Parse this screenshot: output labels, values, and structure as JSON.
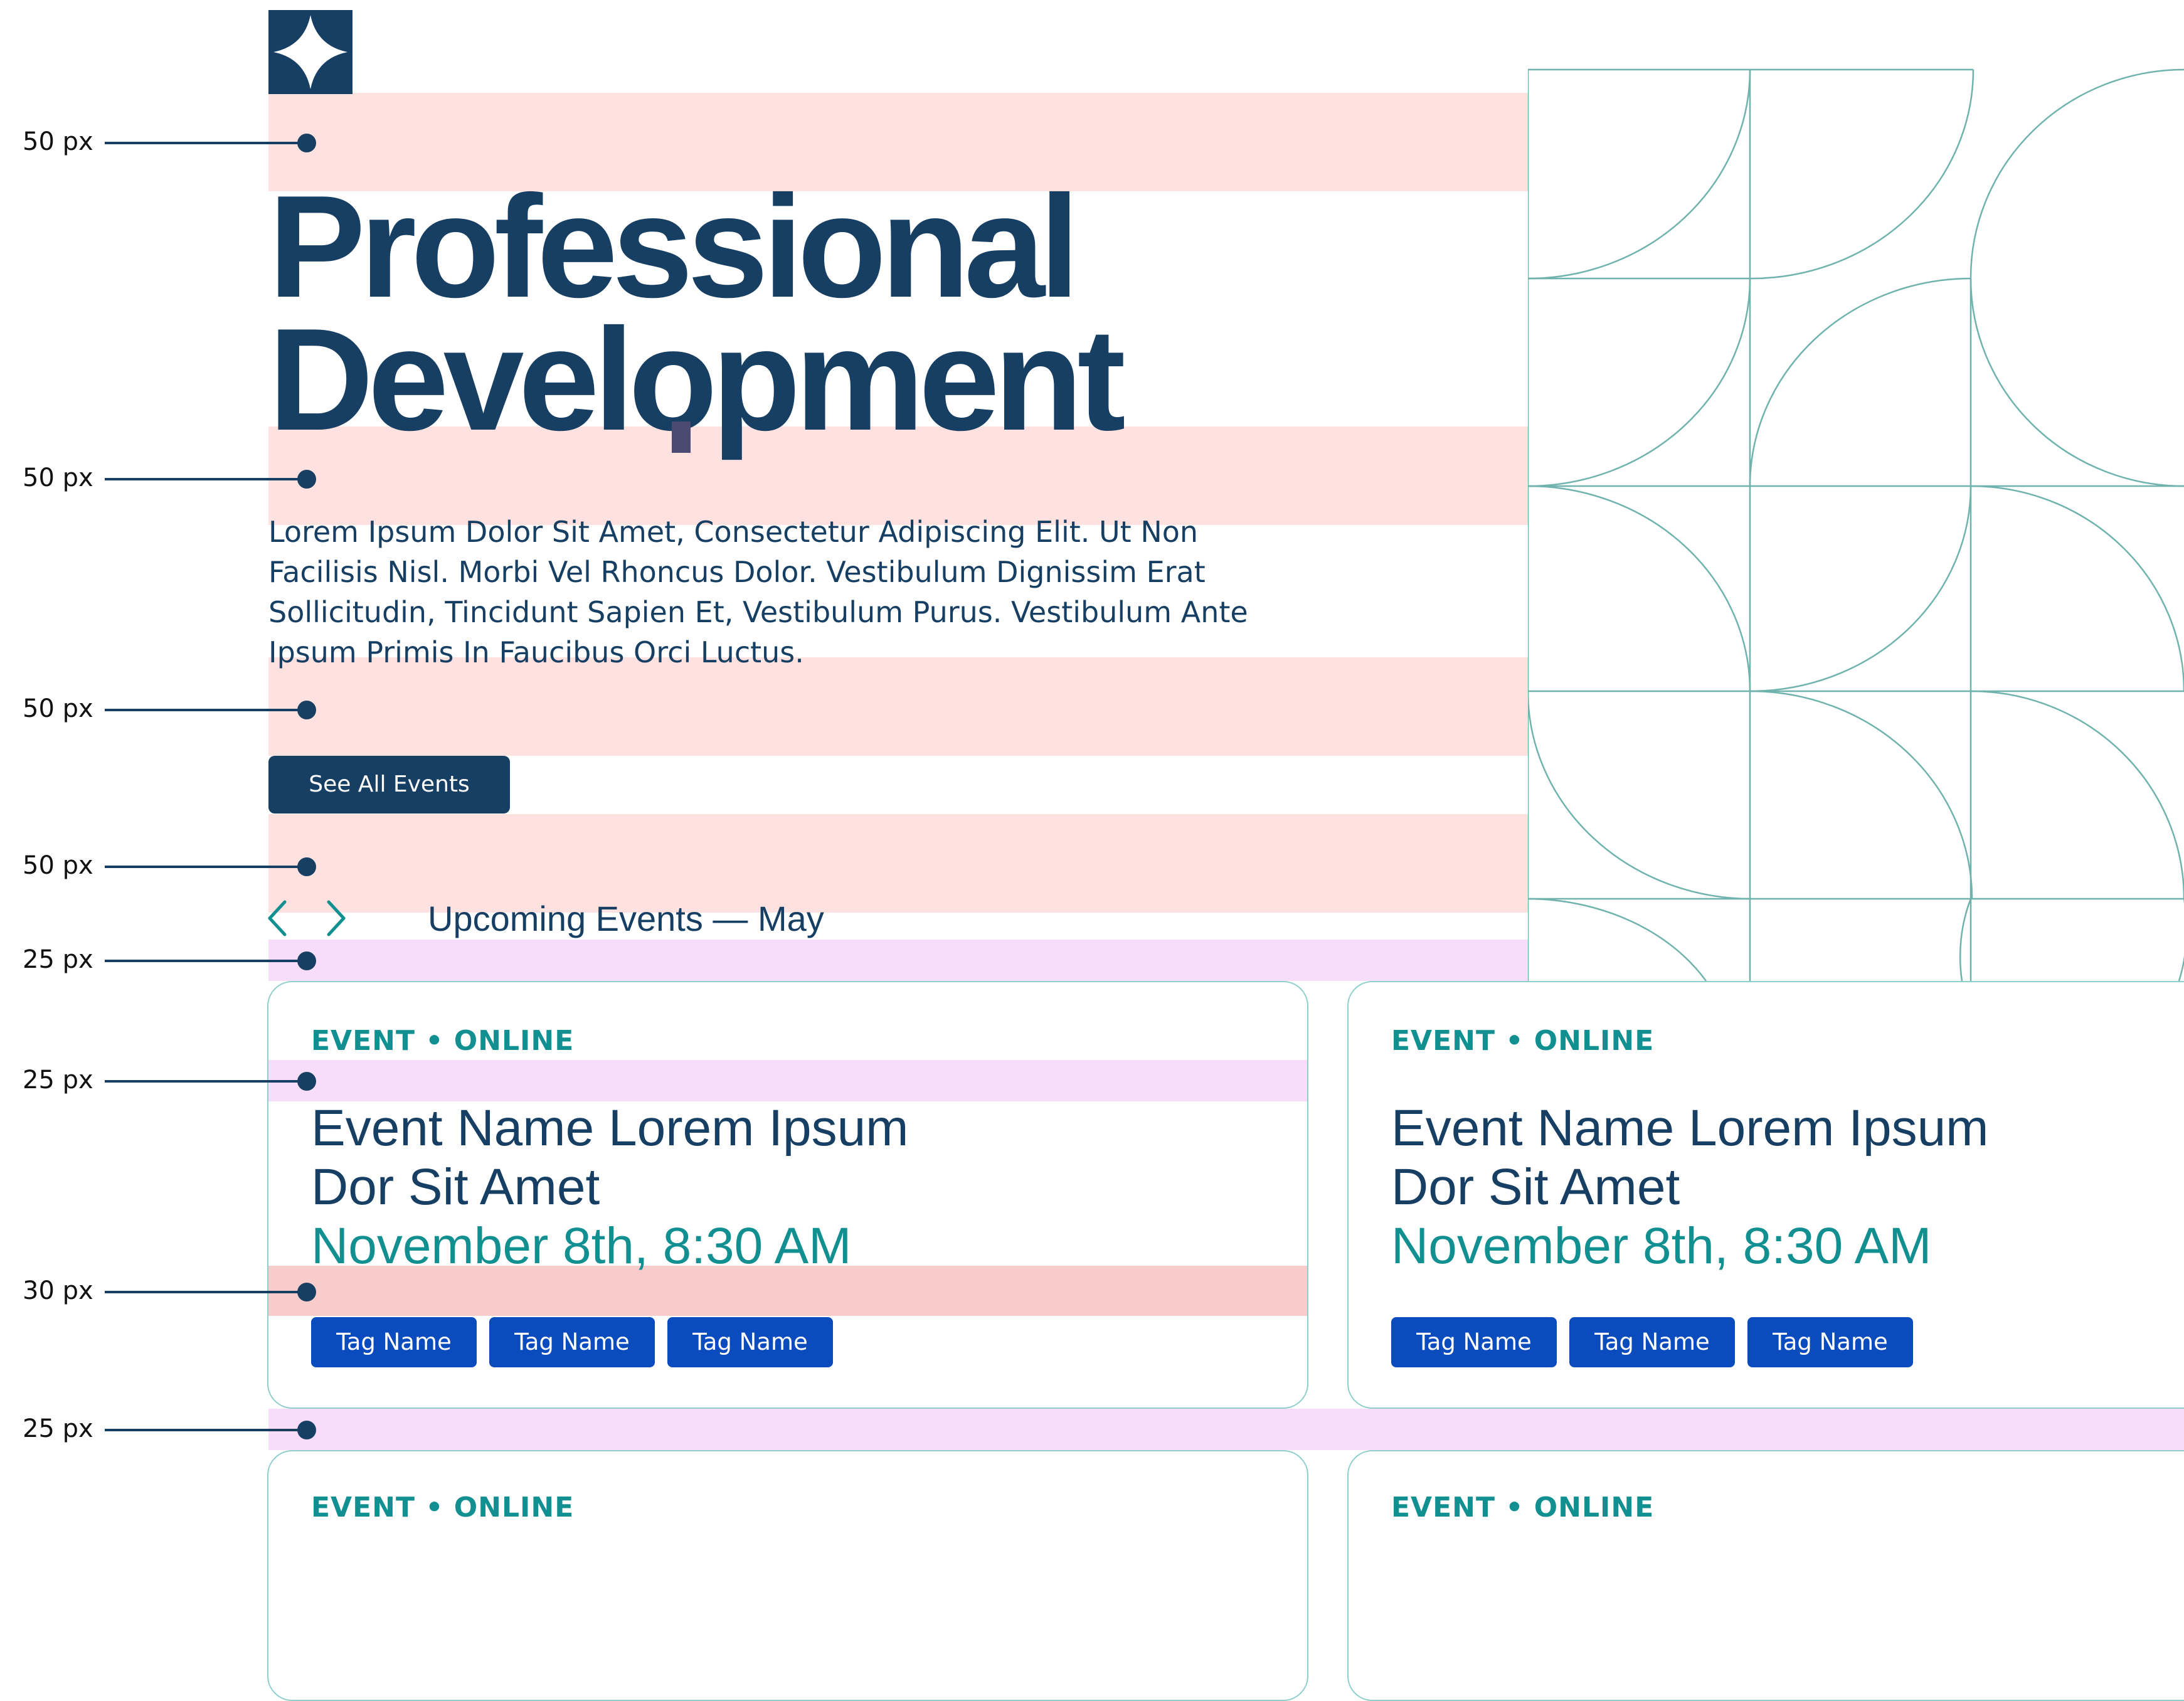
{
  "hero": {
    "title_line1": "Professional",
    "title_line2": "Development",
    "description": "Lorem Ipsum Dolor Sit Amet, Consectetur Adipiscing Elit. Ut Non Facilisis Nisl. Morbi Vel Rhoncus Dolor. Vestibulum Dignissim Erat Sollicitudin, Tincidunt Sapien Et, Vestibulum Purus. Vestibulum Ante Ipsum Primis In Faucibus Orci Luctus.",
    "cta_label": "See All Events"
  },
  "upcoming": {
    "heading": "Upcoming Events — May",
    "prev_icon": "chevron-left-icon",
    "next_icon": "chevron-right-icon"
  },
  "annotations": [
    "50 px",
    "50 px",
    "50 px",
    "50 px",
    "25 px",
    "25 px",
    "30 px",
    "25 px"
  ],
  "cards": [
    {
      "kicker": "EVENT • ONLINE",
      "name_line1": "Event Name Lorem Ipsum",
      "name_line2": "Dor Sit Amet",
      "date": "November 8th, 8:30 AM",
      "tags": [
        "Tag Name",
        "Tag Name",
        "Tag Name"
      ]
    },
    {
      "kicker": "EVENT • ONLINE",
      "name_line1": "Event Name Lorem Ipsum",
      "name_line2": "Dor Sit Amet",
      "date": "November 8th, 8:30 AM",
      "tags": [
        "Tag Name",
        "Tag Name",
        "Tag Name"
      ]
    },
    {
      "kicker": "EVENT • ONLINE"
    },
    {
      "kicker": "EVENT • ONLINE"
    }
  ],
  "colors": {
    "navy": "#173f63",
    "teal": "#129091",
    "tag_blue": "#0a4bbd",
    "spacing_salmon": "#ffe1df",
    "spacing_pink": "#f8ddfb",
    "pattern_stroke": "#6fb3ac"
  },
  "icons": {
    "logo": "sparkle-icon"
  }
}
